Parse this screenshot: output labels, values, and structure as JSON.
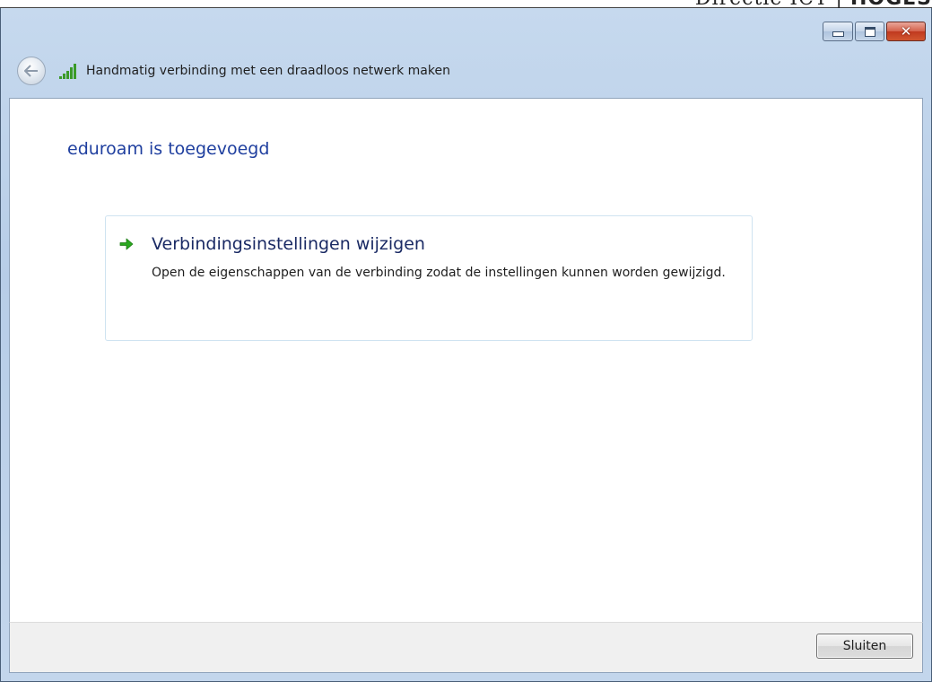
{
  "background": {
    "partial_text_regular": "Directie ICT",
    "partial_text_bold": "HOGES"
  },
  "window": {
    "buttons": {
      "minimize_icon": "minimize-icon",
      "maximize_icon": "maximize-icon",
      "close_glyph": "✕"
    },
    "nav": {
      "title": "Handmatig verbinding met een draadloos netwerk maken",
      "back_icon": "back-arrow-icon",
      "network_icon": "wireless-signal-icon"
    },
    "content": {
      "heading": "eduroam is toegevoegd",
      "option": {
        "title": "Verbindingsinstellingen wijzigen",
        "description": "Open de eigenschappen van de verbinding zodat de instellingen kunnen worden gewijzigd.",
        "icon": "green-arrow-icon"
      }
    },
    "footer": {
      "close_label": "Sluiten"
    }
  },
  "colors": {
    "heading": "#1f3f9f",
    "link_title": "#1a2a64",
    "titlebar": "#c6d9ee",
    "close_button": "#c0391f",
    "signal": "#3a9a28"
  }
}
